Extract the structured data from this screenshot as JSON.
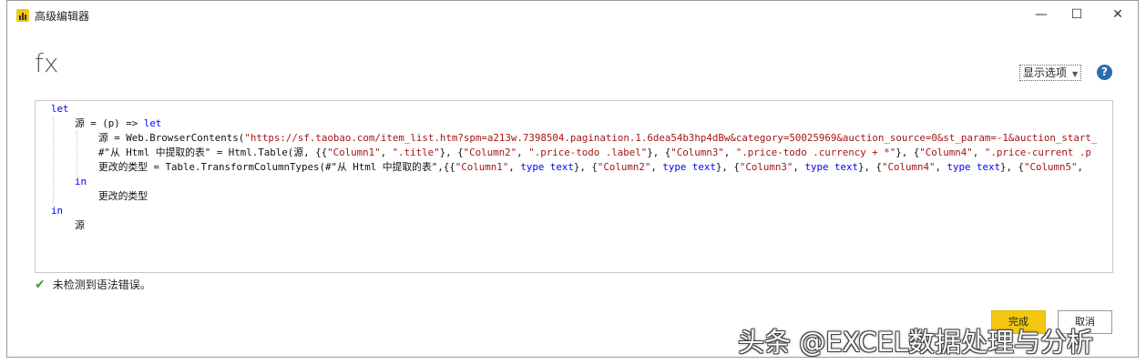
{
  "window": {
    "title": "高级编辑器"
  },
  "window_controls": {
    "minimize": "—",
    "maximize": "☐",
    "close": "✕"
  },
  "formula_bar": {
    "fx": "fx"
  },
  "toolbar": {
    "display_options": "显示选项",
    "help": "?"
  },
  "code_lines": [
    {
      "indent": 0,
      "tokens": [
        {
          "t": "let",
          "c": "kw"
        }
      ]
    },
    {
      "indent": 1,
      "tokens": [
        {
          "t": "源 = (p) => "
        },
        {
          "t": "let",
          "c": "kw"
        }
      ]
    },
    {
      "indent": 2,
      "tokens": [
        {
          "t": "源 = Web.BrowserContents("
        },
        {
          "t": "\"https://sf.taobao.com/item_list.htm?spm=a213w.7398504.pagination.1.6dea54b3hp4dBw&category=50025969&auction_source=0&st_param=-1&auction_start_",
          "c": "str"
        }
      ]
    },
    {
      "indent": 2,
      "tokens": [
        {
          "t": "#\"从 Html 中提取的表\" = Html.Table(源, {{"
        },
        {
          "t": "\"Column1\"",
          "c": "str"
        },
        {
          "t": ", "
        },
        {
          "t": "\".title\"",
          "c": "str"
        },
        {
          "t": "}, {"
        },
        {
          "t": "\"Column2\"",
          "c": "str"
        },
        {
          "t": ", "
        },
        {
          "t": "\".price-todo .label\"",
          "c": "str"
        },
        {
          "t": "}, {"
        },
        {
          "t": "\"Column3\"",
          "c": "str"
        },
        {
          "t": ", "
        },
        {
          "t": "\".price-todo .currency + *\"",
          "c": "str"
        },
        {
          "t": "}, {"
        },
        {
          "t": "\"Column4\"",
          "c": "str"
        },
        {
          "t": ", "
        },
        {
          "t": "\".price-current .p",
          "c": "str"
        }
      ]
    },
    {
      "indent": 2,
      "tokens": [
        {
          "t": "更改的类型 = Table.TransformColumnTypes(#\"从 Html 中提取的表\",{{"
        },
        {
          "t": "\"Column1\"",
          "c": "str"
        },
        {
          "t": ", "
        },
        {
          "t": "type text",
          "c": "type"
        },
        {
          "t": "}, {"
        },
        {
          "t": "\"Column2\"",
          "c": "str"
        },
        {
          "t": ", "
        },
        {
          "t": "type text",
          "c": "type"
        },
        {
          "t": "}, {"
        },
        {
          "t": "\"Column3\"",
          "c": "str"
        },
        {
          "t": ", "
        },
        {
          "t": "type text",
          "c": "type"
        },
        {
          "t": "}, {"
        },
        {
          "t": "\"Column4\"",
          "c": "str"
        },
        {
          "t": ", "
        },
        {
          "t": "type text",
          "c": "type"
        },
        {
          "t": "}, {"
        },
        {
          "t": "\"Column5\"",
          "c": "str"
        },
        {
          "t": ","
        }
      ]
    },
    {
      "indent": 1,
      "tokens": [
        {
          "t": "in",
          "c": "kw"
        }
      ]
    },
    {
      "indent": 2,
      "tokens": [
        {
          "t": "更改的类型"
        }
      ]
    },
    {
      "indent": 0,
      "tokens": [
        {
          "t": "in",
          "c": "kw"
        }
      ]
    },
    {
      "indent": 1,
      "tokens": [
        {
          "t": "源"
        }
      ]
    }
  ],
  "status": {
    "icon": "check-icon",
    "text": "未检测到语法错误。"
  },
  "buttons": {
    "done": "完成",
    "cancel": "取消"
  },
  "watermark": "头条 @EXCEL数据处理与分析",
  "colors": {
    "accent": "#f2c811",
    "keyword": "#0000ff",
    "string": "#a31515",
    "check": "#3a9c3a",
    "help": "#2b6cb0"
  }
}
